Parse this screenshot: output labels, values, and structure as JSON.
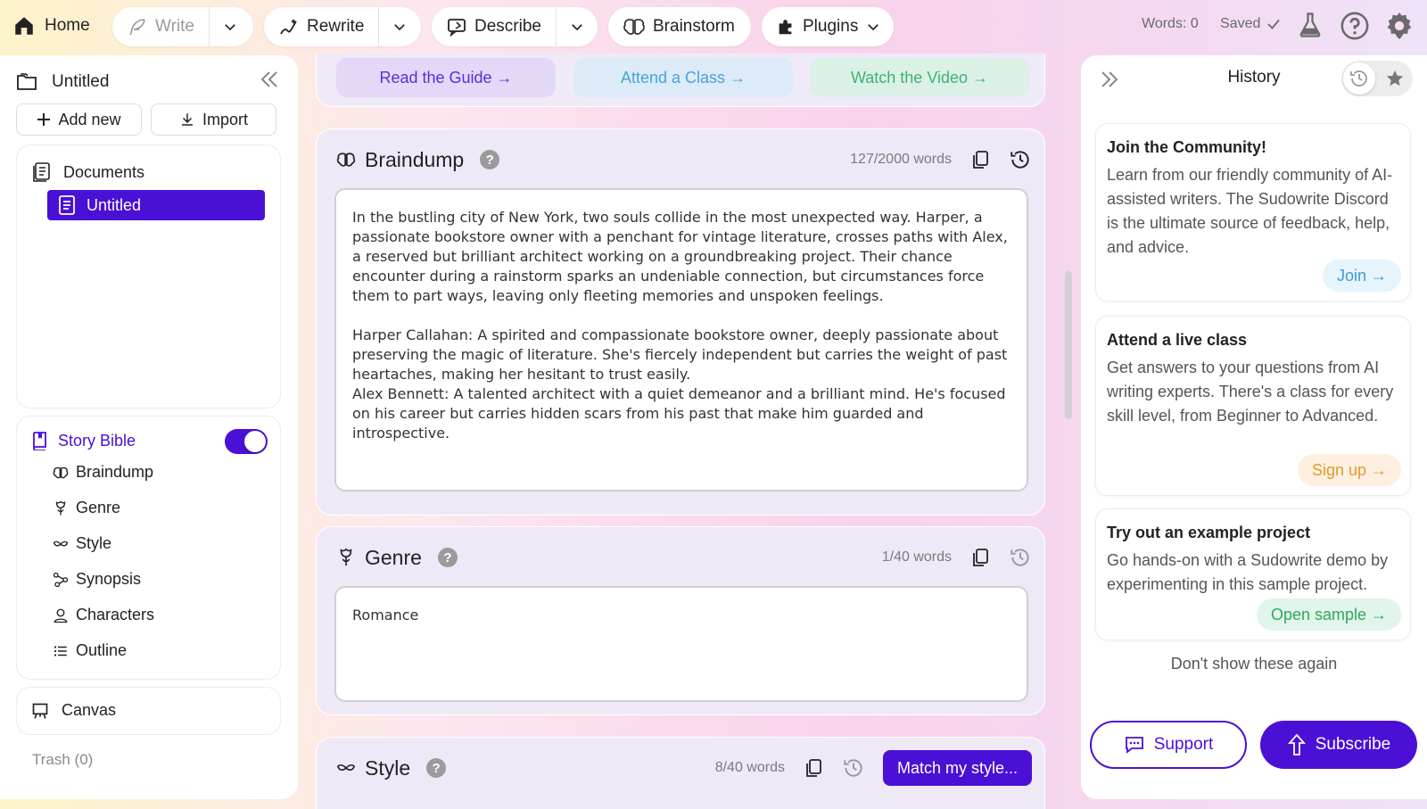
{
  "topbar": {
    "home_label": "Home",
    "write_label": "Write",
    "rewrite_label": "Rewrite",
    "describe_label": "Describe",
    "brainstorm_label": "Brainstorm",
    "plugins_label": "Plugins",
    "words_count": "Words: 0",
    "saved_label": "Saved"
  },
  "sidebar": {
    "project_title": "Untitled",
    "add_new_label": "Add new",
    "import_label": "Import",
    "documents_label": "Documents",
    "active_document": "Untitled",
    "story_bible_label": "Story Bible",
    "story_bible_enabled": true,
    "story_bible_items": [
      {
        "label": "Braindump",
        "icon": "brain-icon"
      },
      {
        "label": "Genre",
        "icon": "rose-icon"
      },
      {
        "label": "Style",
        "icon": "mustache-icon"
      },
      {
        "label": "Synopsis",
        "icon": "nodes-icon"
      },
      {
        "label": "Characters",
        "icon": "person-icon"
      },
      {
        "label": "Outline",
        "icon": "list-icon"
      }
    ],
    "canvas_label": "Canvas",
    "trash_label": "Trash (0)"
  },
  "resources": {
    "guide_label": "Read the Guide →",
    "class_label": "Attend a Class →",
    "video_label": "Watch the Video →"
  },
  "braindump": {
    "title": "Braindump",
    "word_count": "127/2000 words",
    "text": "In the bustling city of New York, two souls collide in the most unexpected way. Harper, a passionate bookstore owner with a penchant for vintage literature, crosses paths with Alex, a reserved but brilliant architect working on a groundbreaking project. Their chance encounter during a rainstorm sparks an undeniable connection, but circumstances force them to part ways, leaving only fleeting memories and unspoken feelings.\n\nHarper Callahan: A spirited and compassionate bookstore owner, deeply passionate about preserving the magic of literature. She's fiercely independent but carries the weight of past heartaches, making her hesitant to trust easily.\nAlex Bennett: A talented architect with a quiet demeanor and a brilliant mind. He's focused on his career but carries hidden scars from his past that make him guarded and introspective."
  },
  "genre": {
    "title": "Genre",
    "word_count": "1/40 words",
    "text": "Romance"
  },
  "style": {
    "title": "Style",
    "word_count": "8/40 words",
    "match_label": "Match my style..."
  },
  "history": {
    "title": "History",
    "cards": [
      {
        "title": "Join the Community!",
        "body": "Learn from our friendly community of AI-assisted writers. The Sudowrite Discord is the ultimate source of feedback, help, and advice.",
        "cta": "Join →"
      },
      {
        "title": "Attend a live class",
        "body": "Get answers to your questions from AI writing experts. There's a class for every skill level, from Beginner to Advanced.",
        "cta": "Sign up →"
      },
      {
        "title": "Try out an example project",
        "body": "Go hands-on with a Sudowrite demo by experimenting in this sample project.",
        "cta": "Open sample →"
      }
    ],
    "dont_show_label": "Don't show these again",
    "support_label": "Support",
    "subscribe_label": "Subscribe"
  },
  "colors": {
    "accent": "#4a10d6",
    "guide": "#e3d8f8",
    "class": "#dcebf7",
    "video": "#dcf1e6"
  }
}
